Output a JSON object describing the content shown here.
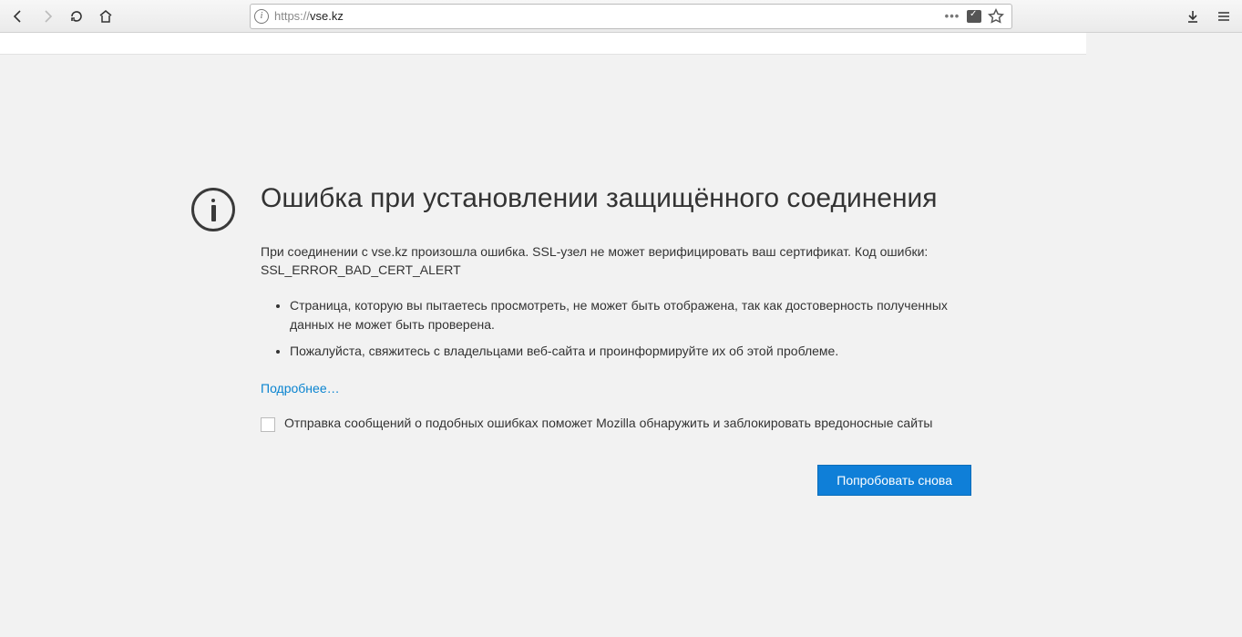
{
  "address_bar": {
    "scheme": "https://",
    "host": "vse.kz",
    "full": "https://vse.kz"
  },
  "error": {
    "title": "Ошибка при установлении защищённого соединения",
    "desc": "При соединении с vse.kz произошла ошибка. SSL-узел не может верифицировать ваш сертификат. Код ошибки: SSL_ERROR_BAD_CERT_ALERT",
    "bullets": [
      "Страница, которую вы пытаетесь просмотреть, не может быть отображена, так как достоверность полученных данных не может быть проверена.",
      "Пожалуйста, свяжитесь с владельцами веб-сайта и проинформируйте их об этой проблеме."
    ],
    "more_link": "Подробнее…",
    "report_label": "Отправка сообщений о подобных ошибках поможет Mozilla обнаружить и заблокировать вредоносные сайты",
    "retry_button": "Попробовать снова"
  }
}
